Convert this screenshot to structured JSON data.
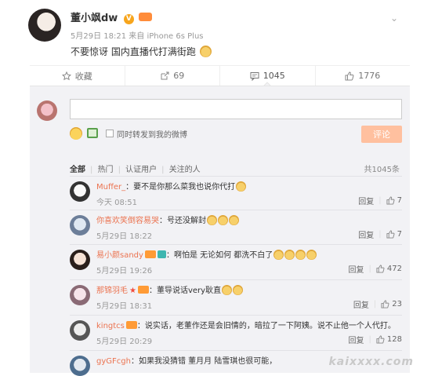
{
  "post": {
    "author": "董小飒dw",
    "verified_mark": "V",
    "time": "5月29日 18:21",
    "source": "来自 iPhone 6s Plus",
    "text": "不要惊讶 国内直播代打满街跑",
    "more_glyph": "⌄"
  },
  "actions": [
    {
      "label": "收藏",
      "icon": "star-icon"
    },
    {
      "label": "69",
      "icon": "share-icon"
    },
    {
      "label": "1045",
      "icon": "comment-icon"
    },
    {
      "label": "1776",
      "icon": "like-icon"
    }
  ],
  "composer": {
    "input_value": "",
    "also_repost_label": "同时转发到我的微博",
    "submit_label": "评论"
  },
  "filters": {
    "all": "全部",
    "hot": "热门",
    "verified": "认证用户",
    "following": "关注的人",
    "total": "共1045条"
  },
  "comments": [
    {
      "user": "Muffer_",
      "text": "：要不是你那么菜我也说你代打",
      "time": "今天 08:51",
      "reply": "回复",
      "likes": "7"
    },
    {
      "user": "你喜欢笑倒容易哭",
      "text": "：号还没解封",
      "time": "5月29日 18:22",
      "reply": "回复",
      "likes": "7"
    },
    {
      "user": "易小颜sandy",
      "text": "：啊怕是 无论如何 都洗不白了",
      "time": "5月29日 19:26",
      "reply": "回复",
      "likes": "472"
    },
    {
      "user": "那锦羽毛",
      "text": "：董导说话very耿直",
      "time": "5月29日 18:31",
      "reply": "回复",
      "likes": "23"
    },
    {
      "user": "kingtcs",
      "text": "：说实话，老董作还是会旧情的，暗拉了一下阿姨。说不止他一个人代打。",
      "time": "5月29日 20:29",
      "reply": "回复",
      "likes": "128"
    },
    {
      "user": "gyGFcgh",
      "text": "：如果我没猜错 董月月 陆雪琪也很可能，",
      "time": "",
      "reply": "",
      "likes": ""
    }
  ],
  "watermark": "kaixxxx.com",
  "colors": {
    "accent_orange": "#eb7350",
    "submit_bg": "#ffc09f",
    "panel_bg": "#f2f2f5"
  }
}
